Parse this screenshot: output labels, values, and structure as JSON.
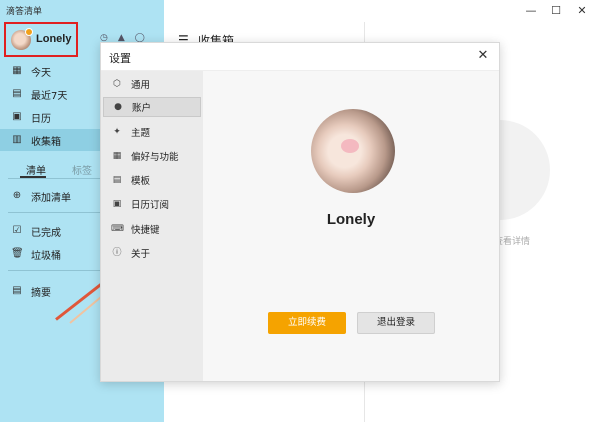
{
  "window": {
    "app_title": "滴答清单",
    "minimize_glyph": "—",
    "maximize_glyph": "☐",
    "close_glyph": "✕"
  },
  "user": {
    "name": "Lonely"
  },
  "sidebar": {
    "top_icons": [
      "clock-icon",
      "droplet-icon",
      "search-icon"
    ],
    "nav": [
      {
        "label": "今天",
        "icon": "calendar-today-icon",
        "glyph": "▦"
      },
      {
        "label": "最近7天",
        "icon": "calendar-week-icon",
        "glyph": "▤"
      },
      {
        "label": "日历",
        "icon": "calendar-icon",
        "glyph": "▣"
      },
      {
        "label": "收集箱",
        "icon": "inbox-icon",
        "glyph": "▥"
      }
    ],
    "tabs": {
      "lists": "清单",
      "tags": "标签"
    },
    "add_list": {
      "label": "添加清单",
      "glyph": "⊕"
    },
    "completed": {
      "label": "已完成",
      "glyph": "☑"
    },
    "trash": {
      "label": "垃圾桶",
      "glyph": "🗑"
    },
    "summary": {
      "label": "摘要",
      "glyph": "▤"
    }
  },
  "middle": {
    "title": "收集箱"
  },
  "right_pane": {
    "hint": "查看详情"
  },
  "dialog": {
    "title": "设置",
    "close_glyph": "✕",
    "menu": [
      {
        "label": "通用",
        "glyph": "⬡"
      },
      {
        "label": "账户",
        "glyph": "●"
      },
      {
        "label": "主题",
        "glyph": "✦"
      },
      {
        "label": "偏好与功能",
        "glyph": "▦"
      },
      {
        "label": "模板",
        "glyph": "▤"
      },
      {
        "label": "日历订阅",
        "glyph": "▣"
      },
      {
        "label": "快捷键",
        "glyph": "⌨"
      },
      {
        "label": "关于",
        "glyph": "ⓘ"
      }
    ],
    "active_menu": "账户",
    "account": {
      "name": "Lonely",
      "renew_button": "立即续费",
      "logout_button": "退出登录"
    }
  },
  "colors": {
    "sidebar_bg": "#aee3f3",
    "accent_orange": "#f5a300",
    "highlight_red": "#e02020"
  }
}
